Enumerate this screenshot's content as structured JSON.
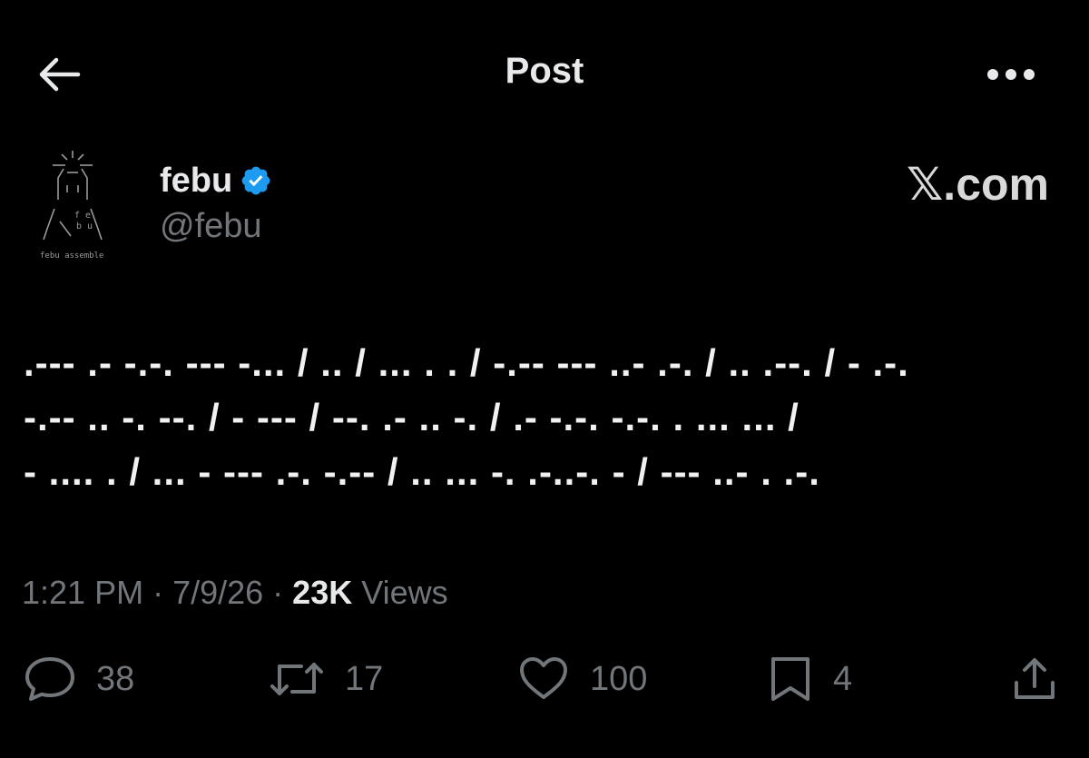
{
  "header": {
    "title": "Post",
    "back_icon": "arrow-left-icon",
    "more_icon": "more-horizontal-icon"
  },
  "author": {
    "name": "febu",
    "handle": "@febu",
    "verified": true,
    "avatar_text": "febu assemble"
  },
  "brand": {
    "logo_text": "𝕏.com"
  },
  "post": {
    "lines": [
      ".--- .- -.-. --- -... / .. / ... . . / -.-- --- ..- .-. / .. .--. / - .-.",
      "-.-- .. -. --. / - --- / --. .- .. -. / .- -.-. -.-. . ... ... /",
      "- .... . / ... - --- .-. -.-- / .. ... -. .-..-. - / --- ..- . .-."
    ]
  },
  "meta": {
    "time": "1:21 PM",
    "date": "7/9/26",
    "separator": " · ",
    "views_count": "23K",
    "views_label": " Views"
  },
  "actions": {
    "reply_count": "38",
    "repost_count": "17",
    "like_count": "100",
    "bookmark_count": "4"
  },
  "colors": {
    "background": "#000000",
    "text": "#e7e9ea",
    "secondary": "#71767b",
    "verified": "#1d9bf0"
  }
}
